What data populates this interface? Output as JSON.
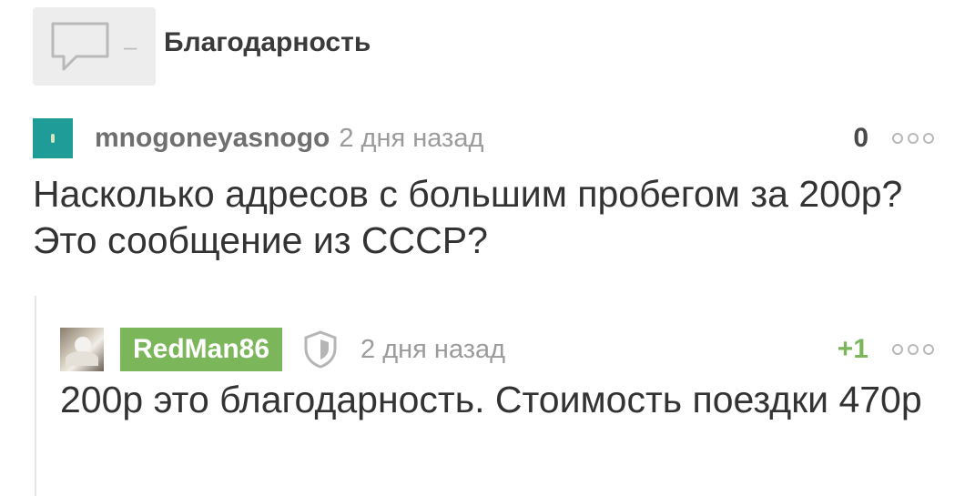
{
  "post": {
    "title": "Благодарность",
    "dash": "–"
  },
  "comments": [
    {
      "username": "mnogoneyasnogo",
      "time": "2 дня назад",
      "rating": "0",
      "text": "Насколько адресов с большим пробегом за 200р? Это сообщение из СССР?"
    },
    {
      "username": "RedMan86",
      "time": "2 дня назад",
      "rating": "+1",
      "text": "200р это благодарность. Стоимость поездки 470р"
    }
  ],
  "colors": {
    "accent_green": "#7cb65a",
    "avatar_teal": "#1f9c98",
    "muted": "#9b9b9b"
  }
}
